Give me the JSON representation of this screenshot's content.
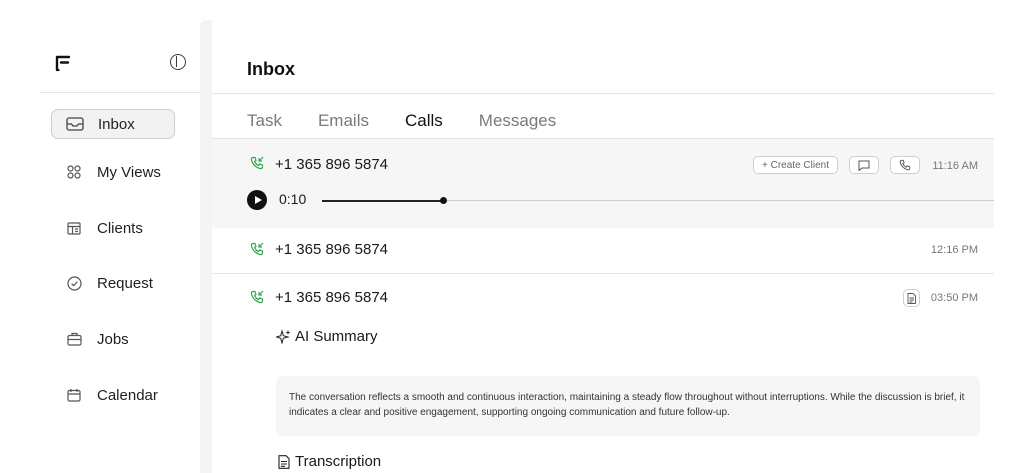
{
  "app": {
    "logo": "brand-logo"
  },
  "sidebar": {
    "collapse_icon": "sidebar-toggle-icon",
    "items": [
      {
        "key": "inbox",
        "label": "Inbox",
        "icon": "inbox-icon",
        "active": true
      },
      {
        "key": "my-views",
        "label": "My Views",
        "icon": "grid-icon",
        "active": false
      },
      {
        "key": "clients",
        "label": "Clients",
        "icon": "layout-icon",
        "active": false
      },
      {
        "key": "request",
        "label": "Request",
        "icon": "check-circle-icon",
        "active": false
      },
      {
        "key": "jobs",
        "label": "Jobs",
        "icon": "briefcase-icon",
        "active": false
      },
      {
        "key": "calendar",
        "label": "Calendar",
        "icon": "calendar-icon",
        "active": false
      }
    ]
  },
  "main": {
    "title": "Inbox",
    "tabs": [
      {
        "label": "Task",
        "active": false
      },
      {
        "label": "Emails",
        "active": false
      },
      {
        "label": "Calls",
        "active": true
      },
      {
        "label": "Messages",
        "active": false
      }
    ],
    "calls": [
      {
        "number": "+1 365 896 5874",
        "time": "11:16 AM",
        "create_client_label": "+ Create Client",
        "message_icon": "message-icon",
        "call_icon": "phone-icon",
        "player": {
          "elapsed": "0:10",
          "progress": 0.18
        }
      },
      {
        "number": "+1 365 896 5874",
        "time": "12:16 PM"
      },
      {
        "number": "+1 365 896 5874",
        "time": "03:50 PM",
        "doc_icon": "document-icon",
        "ai_summary_title": "AI Summary",
        "ai_summary_text": "The conversation reflects a smooth and continuous interaction, maintaining a steady flow throughout without interruptions. While the discussion is brief, it indicates a clear and positive engagement, supporting ongoing communication and future follow-up.",
        "transcription_title": "Transcription"
      }
    ]
  },
  "colors": {
    "accent": "#111111",
    "incoming_call": "#2fa84f",
    "row_highlight": "#f6f6f6"
  }
}
